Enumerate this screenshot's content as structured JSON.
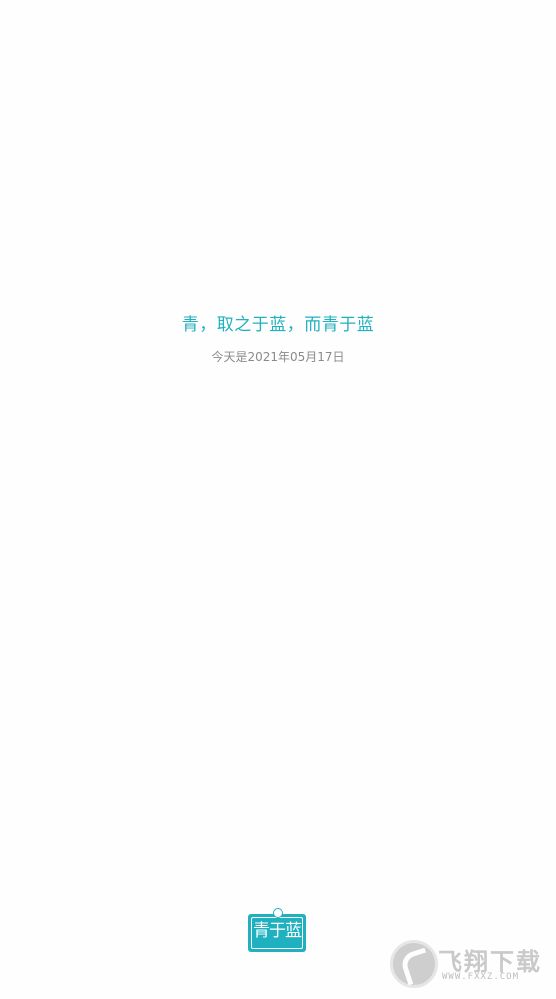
{
  "splash": {
    "slogan": "青，取之于蓝，而青于蓝",
    "date_text": "今天是2021年05月17日"
  },
  "logo": {
    "text": "青于蓝",
    "icon": "hanging-sign-logo"
  },
  "watermark": {
    "title": "飞翔下载",
    "url": "WWW.FXXZ.COM",
    "icon": "fxxz-logo-icon"
  },
  "colors": {
    "accent": "#1fb1bf",
    "date_text": "#8a8a8a",
    "background": "#fefefe"
  }
}
